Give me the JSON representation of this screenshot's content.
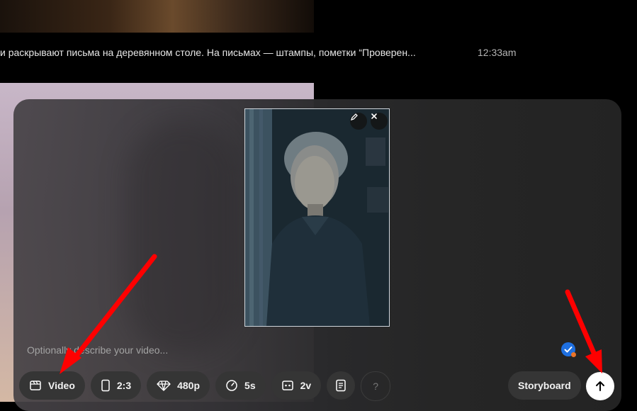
{
  "chat": {
    "message_text": "и раскрывают письма на деревянном столе. На письмах — штампы, пометки “Проверен...",
    "message_time": "12:33am"
  },
  "composer": {
    "prompt": {
      "placeholder": "Optionally describe your video...",
      "value": ""
    },
    "thumbnail": {
      "edit_icon": "pencil-icon",
      "close_icon": "close-icon"
    },
    "toolbar": {
      "mode_label": "Video",
      "aspect_label": "2:3",
      "quality_label": "480p",
      "duration_label": "5s",
      "variants_label": "2v",
      "help_label": "?"
    },
    "storyboard_label": "Storyboard",
    "send_icon": "arrow-up-icon"
  },
  "colors": {
    "annotation_arrow": "#ff0000",
    "verify_badge": "#1e6fe0",
    "status_dot": "#e8742a"
  }
}
